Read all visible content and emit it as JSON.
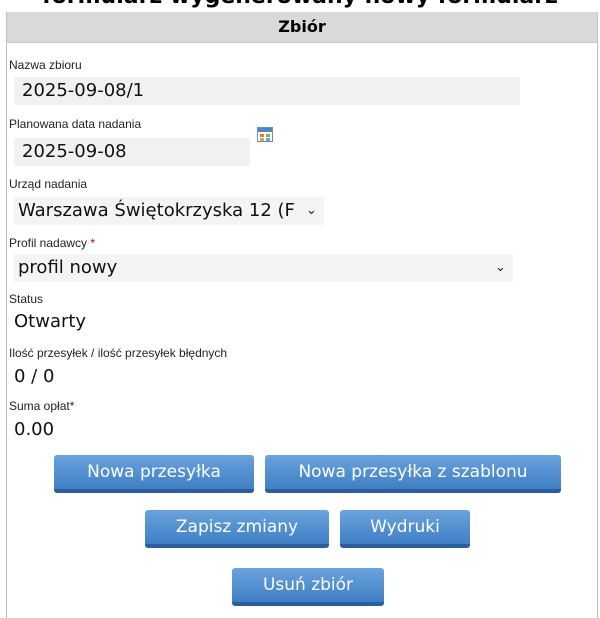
{
  "top_cut_text": "formularz wygenerowany nowy formularz",
  "panel": {
    "title": "Zbiór"
  },
  "fields": {
    "nazwa": {
      "label": "Nazwa zbioru",
      "value": "2025-09-08/1"
    },
    "data": {
      "label": "Planowana data nadania",
      "value": "2025-09-08",
      "icon": "calendar-icon"
    },
    "urzad": {
      "label": "Urząd nadania",
      "value": "Warszawa Świętokrzyska 12 (F",
      "icon": "chevron-down-icon"
    },
    "profil": {
      "label": "Profil nadawcy",
      "required_mark": "*",
      "value": "profil nowy",
      "icon": "chevron-down-icon"
    },
    "status": {
      "label": "Status",
      "value": "Otwarty"
    },
    "ilosc": {
      "label": "Ilość przesyłek / ilość przesyłek błędnych",
      "value": "0 / 0"
    },
    "suma": {
      "label": "Suma opłat*",
      "value": "0.00"
    }
  },
  "buttons": {
    "nowa": "Nowa przesyłka",
    "nowa_szablon": "Nowa przesyłka z szablonu",
    "zapisz": "Zapisz zmiany",
    "wydruki": "Wydruki",
    "usun": "Usuń zbiór"
  },
  "colors": {
    "button": "#4a8ad0",
    "header": "#d9d9d9",
    "field_bg": "#f1f1f1",
    "required": "#d00000"
  }
}
